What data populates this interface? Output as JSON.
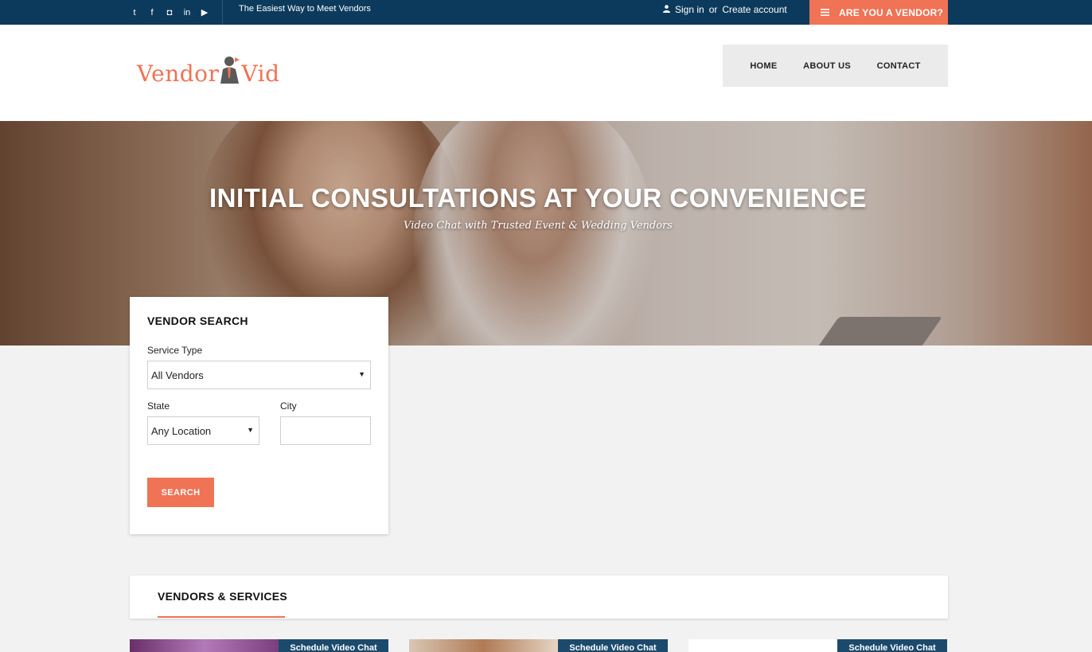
{
  "topbar": {
    "social": [
      "twitter-icon",
      "facebook-icon",
      "instagram-icon",
      "linkedin-icon",
      "youtube-icon"
    ],
    "social_glyphs": [
      "t",
      "f",
      "◘",
      "in",
      "▶"
    ],
    "tagline": "The Easiest Way to Meet Vendors",
    "signin": "Sign in",
    "or": "or",
    "create_account": "Create account",
    "vendor_cta": "ARE YOU A VENDOR?"
  },
  "header": {
    "logo_left": "Vendor",
    "logo_right": "Vid",
    "nav": [
      "HOME",
      "ABOUT US",
      "CONTACT"
    ]
  },
  "hero": {
    "title": "INITIAL CONSULTATIONS AT YOUR CONVENIENCE",
    "subtitle": "Video Chat with Trusted Event & Wedding Vendors"
  },
  "search": {
    "heading": "VENDOR SEARCH",
    "service_label": "Service Type",
    "service_value": "All Vendors",
    "state_label": "State",
    "state_value": "Any Location",
    "city_label": "City",
    "city_value": "",
    "button": "SEARCH"
  },
  "vendors": {
    "heading": "VENDORS & SERVICES",
    "cards": [
      {
        "action": "Schedule Video Chat"
      },
      {
        "action": "Schedule Video Chat"
      },
      {
        "action": "Schedule Video Chat"
      }
    ]
  },
  "colors": {
    "accent": "#ef7354",
    "topbar": "#0c3a5c",
    "card_action": "#1c4a6c"
  }
}
